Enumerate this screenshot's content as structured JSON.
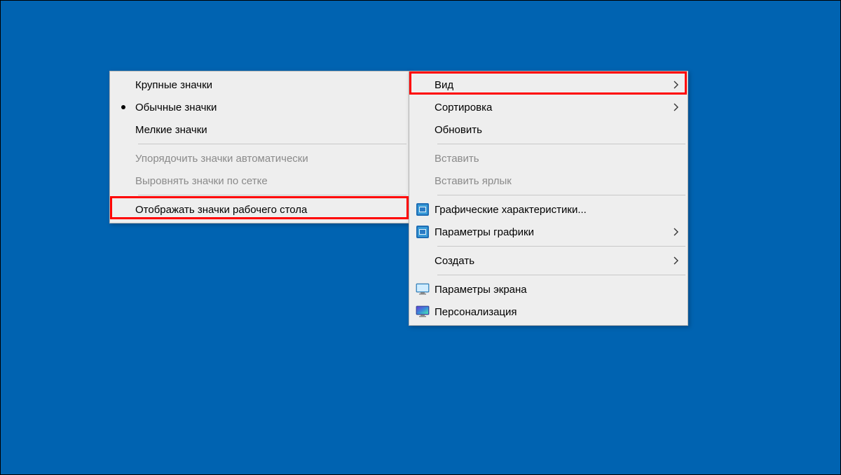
{
  "submenu": {
    "items": [
      {
        "label": "Крупные значки"
      },
      {
        "label": "Обычные значки"
      },
      {
        "label": "Мелкие значки"
      },
      {
        "label": "Упорядочить значки автоматически"
      },
      {
        "label": "Выровнять значки по сетке"
      },
      {
        "label": "Отображать значки рабочего стола"
      }
    ]
  },
  "mainmenu": {
    "items": [
      {
        "label": "Вид"
      },
      {
        "label": "Сортировка"
      },
      {
        "label": "Обновить"
      },
      {
        "label": "Вставить"
      },
      {
        "label": "Вставить ярлык"
      },
      {
        "label": "Графические характеристики..."
      },
      {
        "label": "Параметры графики"
      },
      {
        "label": "Создать"
      },
      {
        "label": "Параметры экрана"
      },
      {
        "label": "Персонализация"
      }
    ]
  }
}
